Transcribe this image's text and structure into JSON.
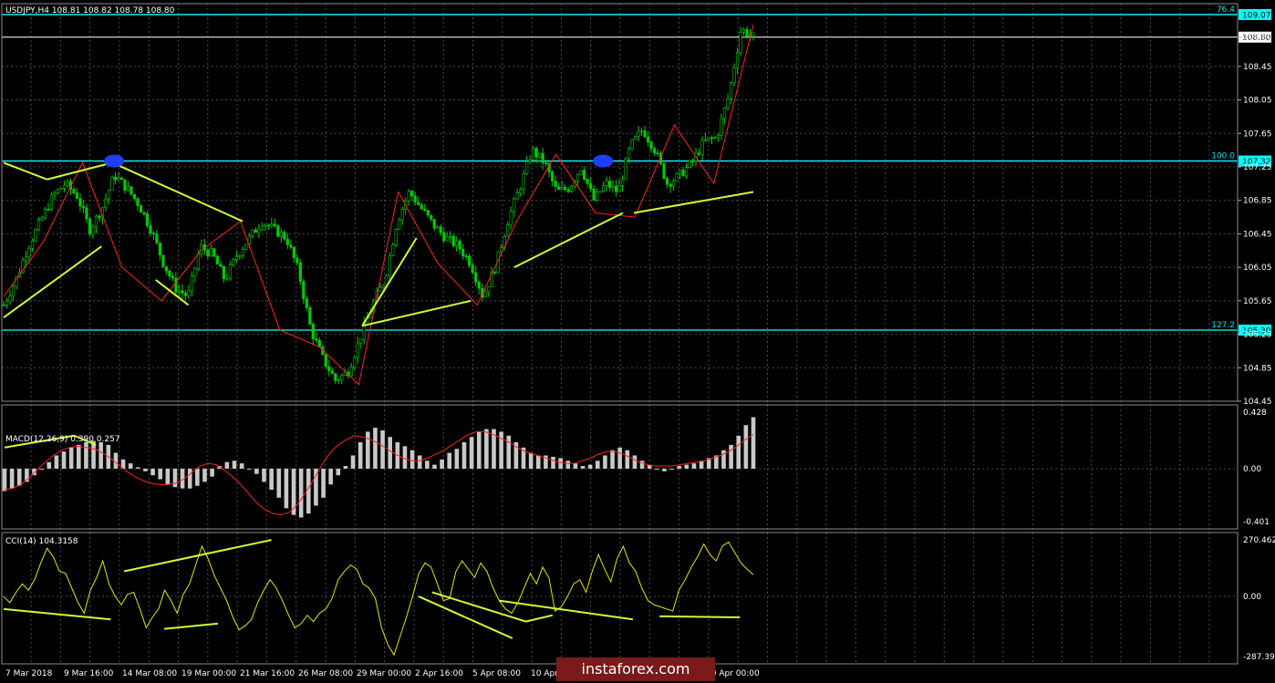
{
  "colors": {
    "background": "#000000",
    "grid": "#4a4a4a",
    "candle": "#00cc00",
    "level_line": "#00ffff",
    "trend_line": "#ccff33",
    "zigzag": "#ff2020",
    "macd_hist": "#c8c8c8",
    "macd_signal": "#ff2020",
    "cci_line": "#e6e600",
    "marker": "#1f3fff"
  },
  "header": {
    "symbol_line": "USDJPY,H4  108.81 108.82 108.78 108.80"
  },
  "chart_data": [
    {
      "type": "candlestick",
      "panel": "price",
      "title": "USDJPY,H4",
      "ohlc_label": "108.81 108.82 108.78 108.80",
      "ylim": [
        104.45,
        109.2
      ],
      "y_ticks": [
        "108.80",
        "108.45",
        "108.05",
        "107.65",
        "107.25",
        "106.85",
        "106.45",
        "106.05",
        "105.65",
        "105.25",
        "104.85",
        "104.45"
      ],
      "x_ticks": [
        "7 Mar 2018",
        "9 Mar 16:00",
        "14 Mar 08:00",
        "19 Mar 00:00",
        "21 Mar 16:00",
        "26 Mar 08:00",
        "29 Mar 00:00",
        "2 Apr 16:00",
        "5 Apr 08:00",
        "10 Apr 00:00",
        "",
        "",
        "19 Apr 00:00"
      ],
      "levels": [
        {
          "price": 109.07,
          "label": "76.4",
          "tag": "109.07"
        },
        {
          "price": 107.32,
          "label": "100.0",
          "tag": "107.32"
        },
        {
          "price": 105.3,
          "label": "127.2",
          "tag": "105.30"
        }
      ],
      "current_price": {
        "price": 108.8,
        "tag": "108.80"
      },
      "close_path": [
        105.6,
        105.9,
        106.3,
        106.6,
        106.9,
        107.05,
        106.9,
        106.5,
        106.75,
        107.15,
        107.0,
        106.8,
        106.5,
        106.1,
        105.8,
        105.7,
        106.3,
        106.2,
        105.9,
        106.2,
        106.4,
        106.6,
        106.5,
        106.4,
        106.0,
        105.3,
        104.95,
        104.7,
        104.8,
        105.2,
        105.6,
        105.9,
        106.6,
        106.95,
        106.75,
        106.55,
        106.4,
        106.3,
        106.1,
        105.7,
        106.05,
        106.6,
        107.0,
        107.45,
        107.3,
        106.95,
        107.0,
        107.25,
        106.85,
        107.05,
        106.95,
        107.5,
        107.7,
        107.45,
        107.05,
        107.15,
        107.3,
        107.55,
        107.6,
        108.1,
        108.9,
        108.8
      ],
      "zigzag_price": [
        105.7,
        106.35,
        107.3,
        106.05,
        105.65,
        106.25,
        106.6,
        105.3,
        105.1,
        104.65,
        106.95,
        106.1,
        105.6,
        106.6,
        107.4,
        106.7,
        106.65,
        107.75,
        107.05,
        108.95
      ],
      "trendlines_price": [
        {
          "from": [
            0,
            107.3
          ],
          "to": [
            4,
            107.1
          ]
        },
        {
          "from": [
            4,
            107.1
          ],
          "to": [
            10,
            107.3
          ]
        },
        {
          "from": [
            10,
            107.3
          ],
          "to": [
            22,
            106.6
          ]
        },
        {
          "from": [
            0,
            105.45
          ],
          "to": [
            9,
            106.3
          ]
        },
        {
          "from": [
            14,
            105.9
          ],
          "to": [
            17,
            105.6
          ]
        },
        {
          "from": [
            33,
            105.35
          ],
          "to": [
            38,
            106.4
          ]
        },
        {
          "from": [
            33,
            105.35
          ],
          "to": [
            43,
            105.65
          ]
        },
        {
          "from": [
            47,
            106.05
          ],
          "to": [
            57,
            106.7
          ]
        },
        {
          "from": [
            58,
            106.7
          ],
          "to": [
            69,
            106.95
          ]
        }
      ],
      "markers": [
        {
          "index": 10,
          "price": 107.32
        },
        {
          "index": 55,
          "price": 107.32
        }
      ]
    },
    {
      "type": "bar",
      "panel": "macd",
      "title": "MACD(12,26,9) 0.390 0.257",
      "ylim": [
        -0.401,
        0.428
      ],
      "y_ticks": [
        "0.428",
        "0.00",
        "-0.401"
      ],
      "histogram": [
        -0.17,
        -0.15,
        -0.13,
        -0.1,
        -0.05,
        0.0,
        0.05,
        0.1,
        0.13,
        0.16,
        0.18,
        0.2,
        0.21,
        0.2,
        0.18,
        0.12,
        0.07,
        0.04,
        0.01,
        -0.02,
        -0.05,
        -0.08,
        -0.12,
        -0.14,
        -0.15,
        -0.15,
        -0.13,
        -0.1,
        -0.06,
        0.02,
        0.05,
        0.06,
        0.04,
        0.0,
        -0.04,
        -0.1,
        -0.16,
        -0.22,
        -0.3,
        -0.35,
        -0.37,
        -0.34,
        -0.28,
        -0.22,
        -0.12,
        -0.05,
        0.02,
        0.1,
        0.2,
        0.28,
        0.31,
        0.29,
        0.24,
        0.2,
        0.17,
        0.14,
        0.1,
        0.06,
        0.03,
        0.07,
        0.12,
        0.15,
        0.2,
        0.24,
        0.28,
        0.3,
        0.3,
        0.28,
        0.25,
        0.2,
        0.16,
        0.12,
        0.1,
        0.1,
        0.09,
        0.08,
        0.06,
        0.04,
        0.02,
        0.03,
        0.06,
        0.1,
        0.14,
        0.16,
        0.14,
        0.1,
        0.06,
        0.03,
        0.0,
        -0.02,
        0.0,
        0.02,
        0.03,
        0.04,
        0.06,
        0.08,
        0.1,
        0.14,
        0.18,
        0.25,
        0.33,
        0.39
      ],
      "signal": [
        -0.16,
        -0.15,
        -0.12,
        -0.07,
        -0.01,
        0.05,
        0.1,
        0.14,
        0.16,
        0.17,
        0.16,
        0.15,
        0.12,
        0.08,
        0.03,
        -0.02,
        -0.06,
        -0.09,
        -0.11,
        -0.12,
        -0.12,
        -0.11,
        -0.08,
        -0.03,
        0.02,
        0.04,
        0.03,
        -0.01,
        -0.06,
        -0.12,
        -0.19,
        -0.26,
        -0.31,
        -0.34,
        -0.35,
        -0.33,
        -0.27,
        -0.18,
        -0.08,
        0.03,
        0.12,
        0.18,
        0.22,
        0.25,
        0.24,
        0.22,
        0.19,
        0.15,
        0.11,
        0.08,
        0.06,
        0.06,
        0.08,
        0.11,
        0.14,
        0.18,
        0.22,
        0.26,
        0.28,
        0.28,
        0.26,
        0.23,
        0.2,
        0.16,
        0.13,
        0.11,
        0.09,
        0.07,
        0.05,
        0.04,
        0.04,
        0.06,
        0.08,
        0.11,
        0.13,
        0.13,
        0.11,
        0.08,
        0.05,
        0.03,
        0.02,
        0.02,
        0.02,
        0.03,
        0.04,
        0.05,
        0.06,
        0.08,
        0.1,
        0.13,
        0.17,
        0.22,
        0.26
      ]
    },
    {
      "type": "line",
      "panel": "cci",
      "title": "CCI(14) 104.3158",
      "ylim": [
        -287.391,
        270.462
      ],
      "y_ticks": [
        "270.462",
        "0.00",
        "-287.391"
      ],
      "values": [
        0,
        -30,
        20,
        60,
        30,
        80,
        160,
        230,
        190,
        120,
        110,
        40,
        -30,
        -80,
        30,
        90,
        170,
        60,
        0,
        -40,
        10,
        20,
        -60,
        -150,
        -100,
        -60,
        30,
        -20,
        -80,
        10,
        60,
        150,
        240,
        180,
        100,
        40,
        -20,
        -100,
        -160,
        -140,
        -110,
        -30,
        30,
        80,
        40,
        -20,
        -90,
        -150,
        -130,
        -90,
        -120,
        -80,
        -60,
        -10,
        80,
        120,
        150,
        130,
        60,
        40,
        -10,
        -150,
        -230,
        -280,
        -190,
        -100,
        0,
        110,
        160,
        140,
        60,
        -20,
        -10,
        120,
        170,
        130,
        90,
        160,
        120,
        40,
        -20,
        -60,
        -80,
        -30,
        40,
        110,
        60,
        140,
        90,
        -70,
        -50,
        0,
        60,
        80,
        20,
        120,
        200,
        130,
        70,
        180,
        240,
        160,
        120,
        40,
        -20,
        -40,
        -50,
        -60,
        -70,
        30,
        80,
        140,
        190,
        250,
        200,
        170,
        240,
        260,
        210,
        160,
        130,
        104
      ]
    }
  ]
}
